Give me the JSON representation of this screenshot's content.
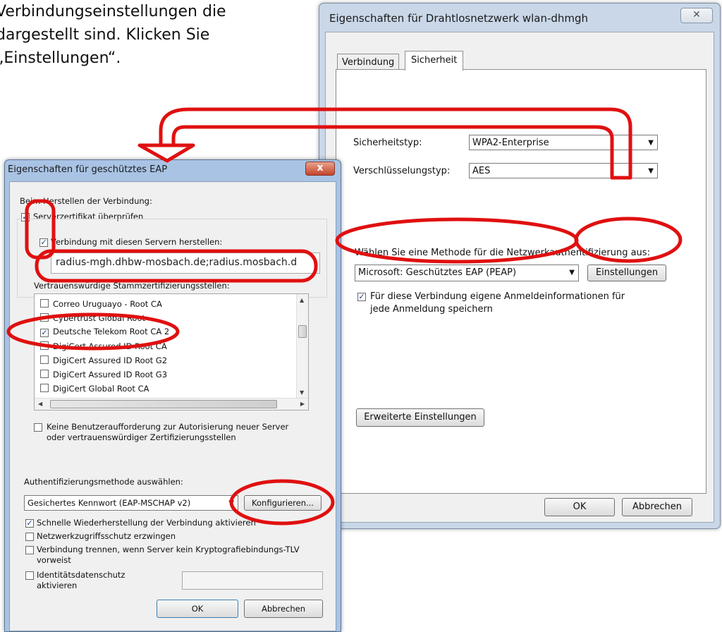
{
  "instruction": {
    "lines": [
      "Verbindungseinstellungen die",
      "dargestellt sind. Klicken Sie",
      "„Einstellungen“."
    ]
  },
  "wlan_dialog": {
    "title": "Eigenschaften für Drahtlosnetzwerk wlan-dhmgh",
    "close_glyph": "✕",
    "tabs": [
      "Verbindung",
      "Sicherheit"
    ],
    "active_tab": "Sicherheit",
    "security_type_label": "Sicherheitstyp:",
    "security_type_value": "WPA2-Enterprise",
    "encryption_type_label": "Verschlüsselungstyp:",
    "encryption_type_value": "AES",
    "auth_method_label": "Wählen Sie eine Methode für die Netzwerkauthentifizierung aus:",
    "auth_method_value": "Microsoft: Geschütztes EAP (PEAP)",
    "settings_button": "Einstellungen",
    "remember_credentials_checked": true,
    "remember_credentials_line1": "Für diese Verbindung eigene Anmeldeinformationen für",
    "remember_credentials_line2": "jede Anmeldung speichern",
    "advanced_button": "Erweiterte Einstellungen",
    "ok_button": "OK",
    "cancel_button": "Abbrechen"
  },
  "eap_dialog": {
    "title": "Eigenschaften für geschütztes EAP",
    "close_glyph": "x",
    "connect_group_label": "Beim Herstellen der Verbindung:",
    "verify_cert_label": "Serverzertifikat überprüfen",
    "verify_cert_checked": true,
    "connect_servers_label": "Verbindung mit diesen Servern herstellen:",
    "connect_servers_checked": true,
    "servers_value": "radius-mgh.dhbw-mosbach.de;radius.mosbach.d",
    "trusted_ca_label": "Vertrauenswürdige Stammzertifizierungsstellen:",
    "ca_list": [
      {
        "name": "Correo Uruguayo - Root CA",
        "checked": false
      },
      {
        "name": "Cybertrust Global Root",
        "checked": false
      },
      {
        "name": "Deutsche Telekom Root CA 2",
        "checked": true
      },
      {
        "name": "DigiCert Assured ID Root CA",
        "checked": false
      },
      {
        "name": "DigiCert Assured ID Root G2",
        "checked": false
      },
      {
        "name": "DigiCert Assured ID Root G3",
        "checked": false
      },
      {
        "name": "DigiCert Global Root CA",
        "checked": false
      }
    ],
    "no_prompt_line1": "Keine Benutzeraufforderung zur Autorisierung neuer Server",
    "no_prompt_line2": "oder vertrauenswürdiger Zertifizierungsstellen",
    "auth_method_label": "Authentifizierungsmethode auswählen:",
    "auth_method_value": "Gesichertes Kennwort (EAP-MSCHAP v2)",
    "configure_button": "Konfigurieren...",
    "fast_reconnect_label": "Schnelle Wiederherstellung der Verbindung aktivieren",
    "fast_reconnect_checked": true,
    "nap_label": "Netzwerkzugriffsschutz erzwingen",
    "disconnect_line1": "Verbindung trennen, wenn Server kein Kryptografiebindungs-TLV",
    "disconnect_line2": "vorweist",
    "identity_line1": "Identitätsdatenschutz",
    "identity_line2": "aktivieren",
    "ok_button": "OK",
    "cancel_button": "Abbrechen"
  },
  "annotation_color": "#e01010"
}
